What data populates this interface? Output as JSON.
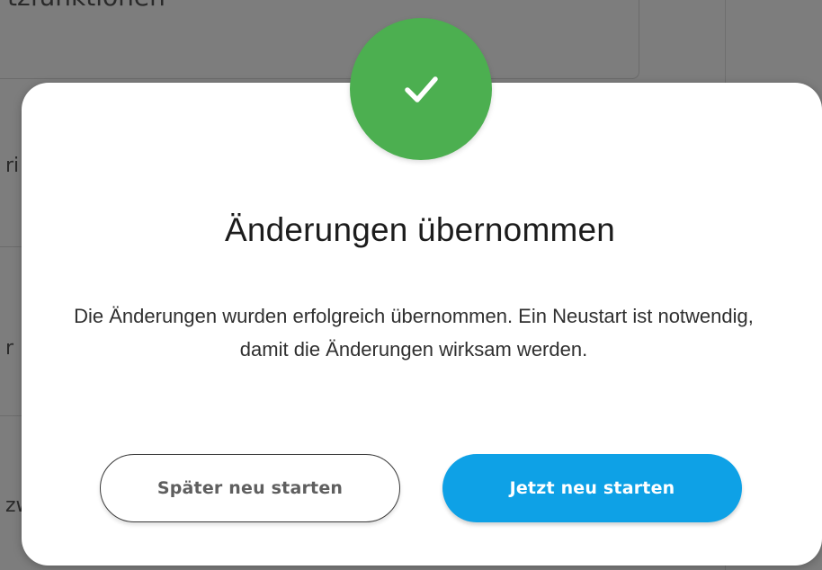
{
  "background": {
    "heading_fragment": "tzfunktionen",
    "row_fragments": [
      "ri",
      "r",
      "zw"
    ]
  },
  "modal": {
    "icon": "checkmark-icon",
    "title": "Änderungen übernommen",
    "message": "Die Änderungen wurden erfolgreich übernommen. Ein Neustart ist notwendig, damit die Änderungen wirksam werden.",
    "buttons": {
      "later_label": "Später neu starten",
      "now_label": "Jetzt neu starten"
    }
  },
  "colors": {
    "success": "#4caf50",
    "primary": "#0ea1e6",
    "overlay": "#7d7d7d"
  }
}
